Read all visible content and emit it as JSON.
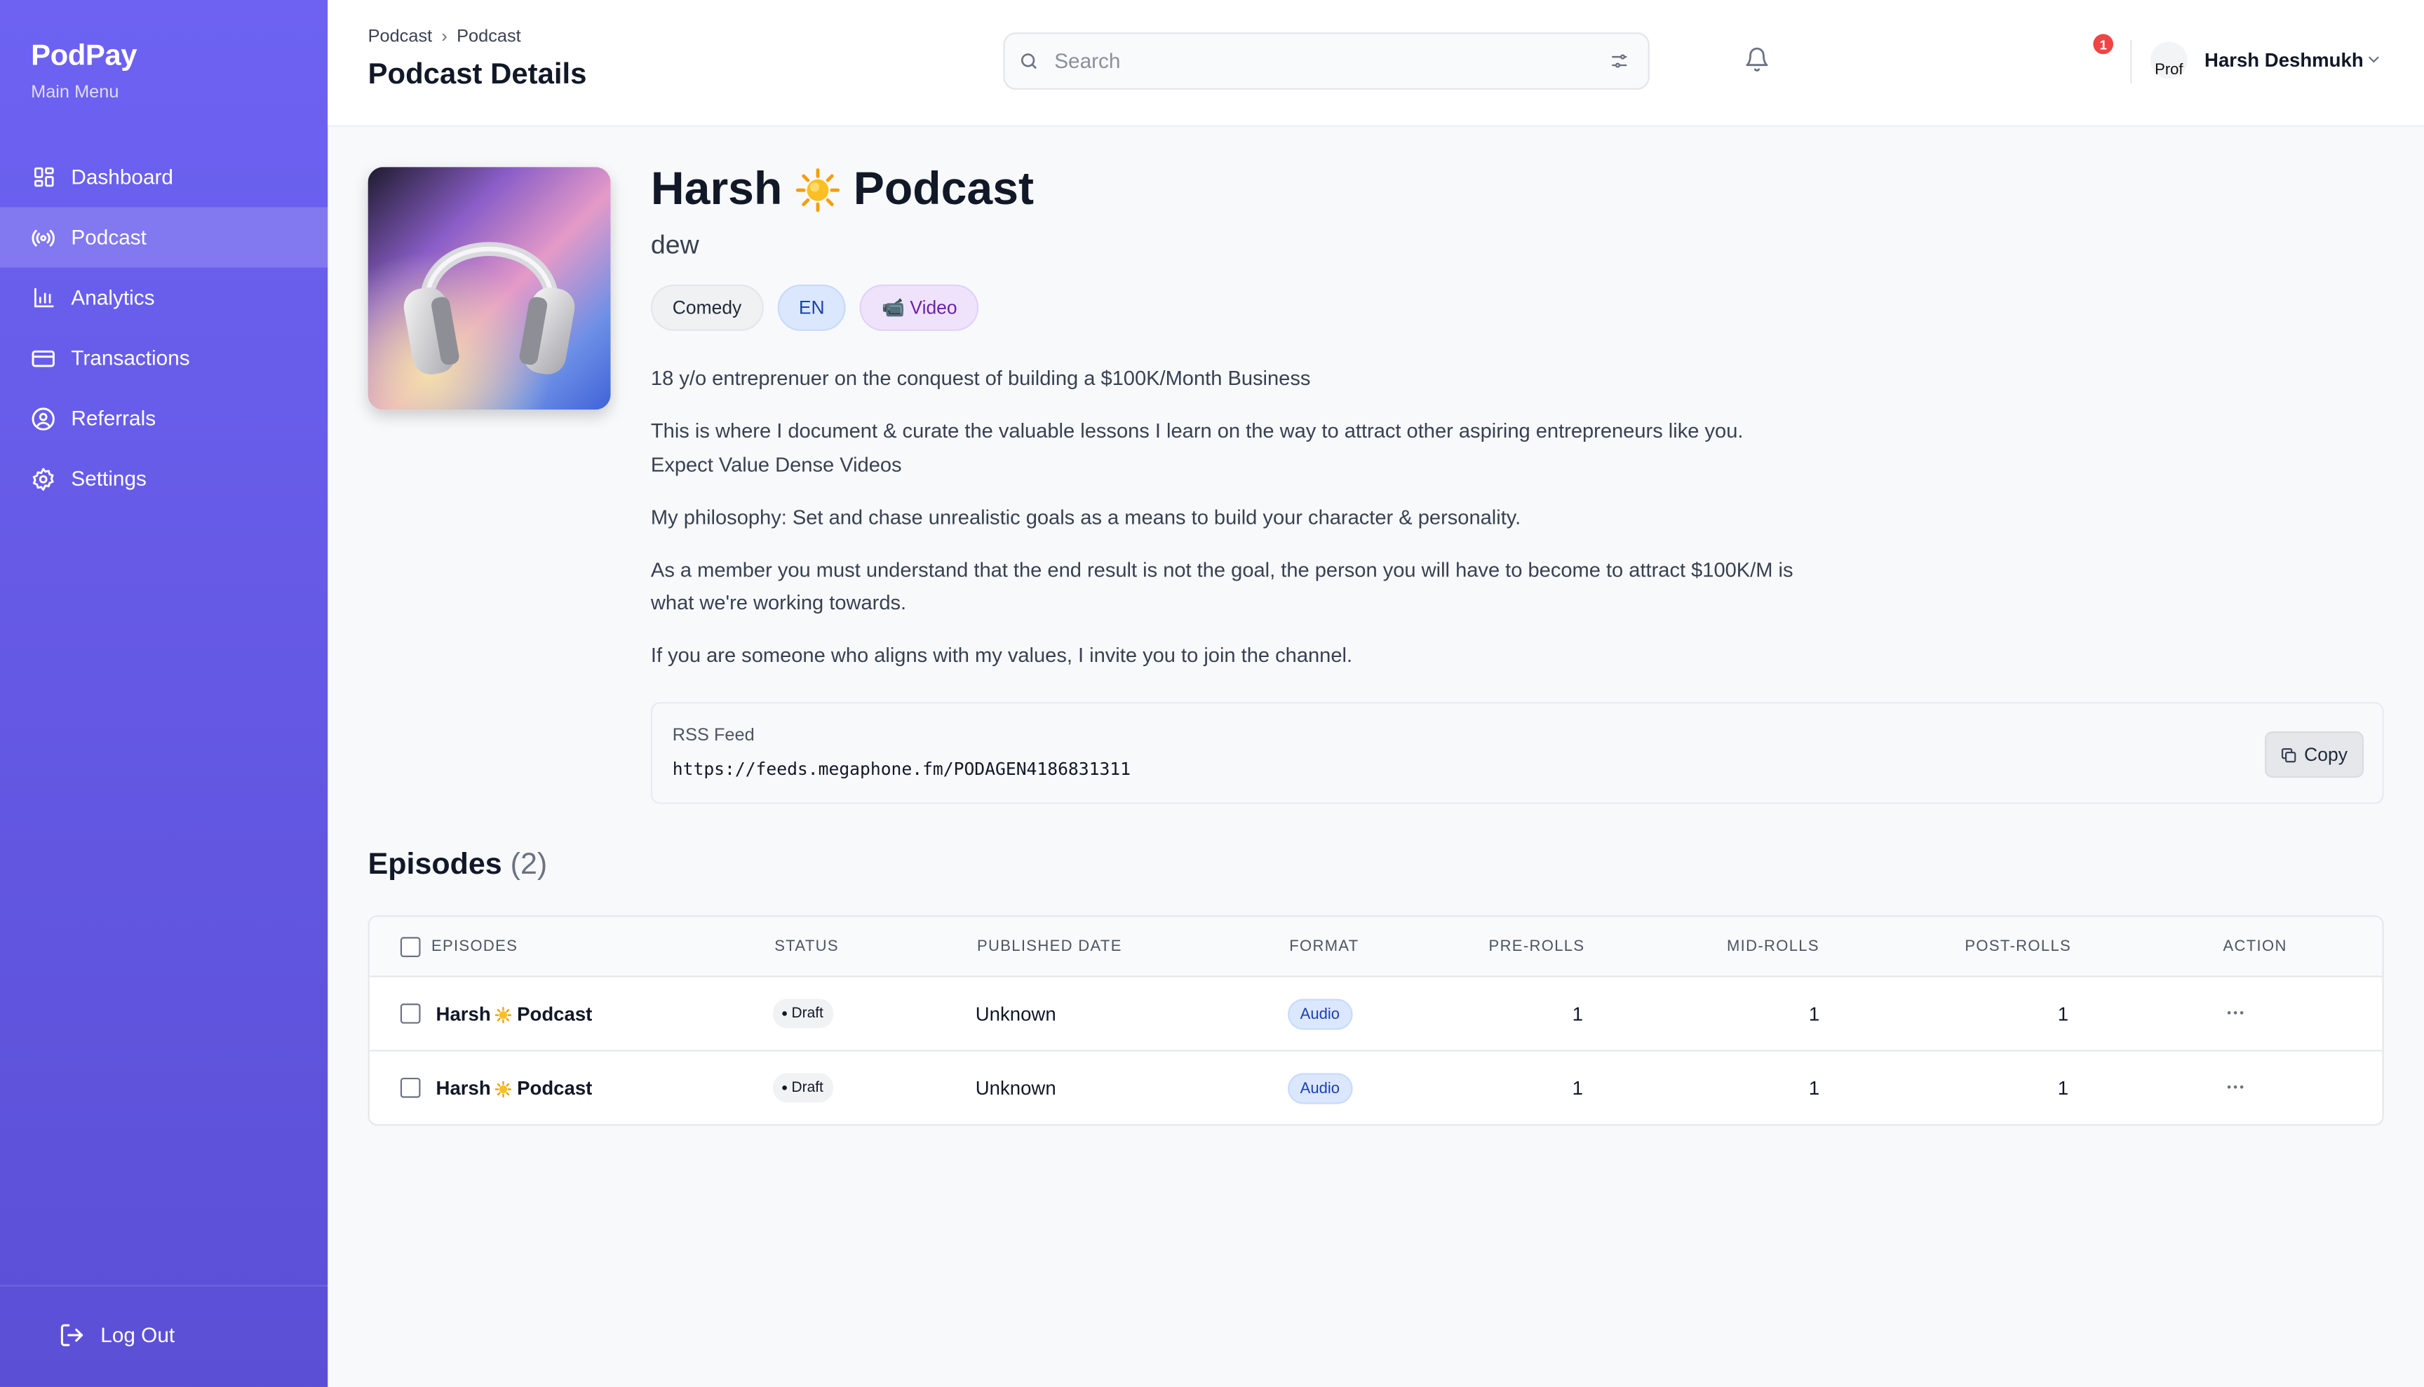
{
  "app": {
    "name": "PodPay",
    "menu_label": "Main Menu"
  },
  "sidebar": {
    "items": [
      {
        "label": "Dashboard",
        "icon": "dashboard-icon",
        "active": false
      },
      {
        "label": "Podcast",
        "icon": "broadcast-icon",
        "active": true
      },
      {
        "label": "Analytics",
        "icon": "bar-chart-icon",
        "active": false
      },
      {
        "label": "Transactions",
        "icon": "credit-card-icon",
        "active": false
      },
      {
        "label": "Referrals",
        "icon": "user-circle-icon",
        "active": false
      },
      {
        "label": "Settings",
        "icon": "gear-icon",
        "active": false
      }
    ],
    "logout_label": "Log Out"
  },
  "header": {
    "breadcrumb": [
      "Podcast",
      "Podcast"
    ],
    "breadcrumb_sep": "›",
    "page_title": "Podcast Details",
    "search_placeholder": "Search",
    "notification_count": "1",
    "avatar_alt": "Prof",
    "user_name": "Harsh Deshmukh"
  },
  "podcast": {
    "title_first": "Harsh",
    "title_last": "Podcast",
    "subtitle": "dew",
    "tags": {
      "category": "Comedy",
      "language": "EN",
      "format": "📹 Video"
    },
    "description": [
      "18 y/o entreprenuer on the conquest of building a $100K/Month Business",
      "This is where I document & curate the valuable lessons I learn on the way to attract other aspiring entrepreneurs like you. Expect Value Dense Videos",
      "My philosophy: Set and chase unrealistic goals as a means to build your character & personality.",
      "As a member you must understand that the end result is not the goal, the person you will have to become to attract $100K/M is what we're working towards.",
      "If you are someone who aligns with my values, I invite you to join the channel."
    ],
    "rss": {
      "label": "RSS Feed",
      "url": "https://feeds.megaphone.fm/PODAGEN4186831311",
      "copy_label": "Copy"
    }
  },
  "episodes": {
    "heading": "Episodes",
    "count": "(2)",
    "columns": [
      "EPISODES",
      "STATUS",
      "PUBLISHED DATE",
      "FORMAT",
      "PRE-ROLLS",
      "MID-ROLLS",
      "POST-ROLLS",
      "ACTION"
    ],
    "rows": [
      {
        "title_first": "Harsh",
        "title_last": "Podcast",
        "status": "Draft",
        "published": "Unknown",
        "format": "Audio",
        "pre_rolls": "1",
        "mid_rolls": "1",
        "post_rolls": "1"
      },
      {
        "title_first": "Harsh",
        "title_last": "Podcast",
        "status": "Draft",
        "published": "Unknown",
        "format": "Audio",
        "pre_rolls": "1",
        "mid_rolls": "1",
        "post_rolls": "1"
      }
    ]
  },
  "colors": {
    "sidebar_top": "#6d62f2",
    "sidebar_bottom": "#5b4fd6",
    "badge_red": "#ef4444",
    "audio_badge": "#dbe7fd"
  }
}
